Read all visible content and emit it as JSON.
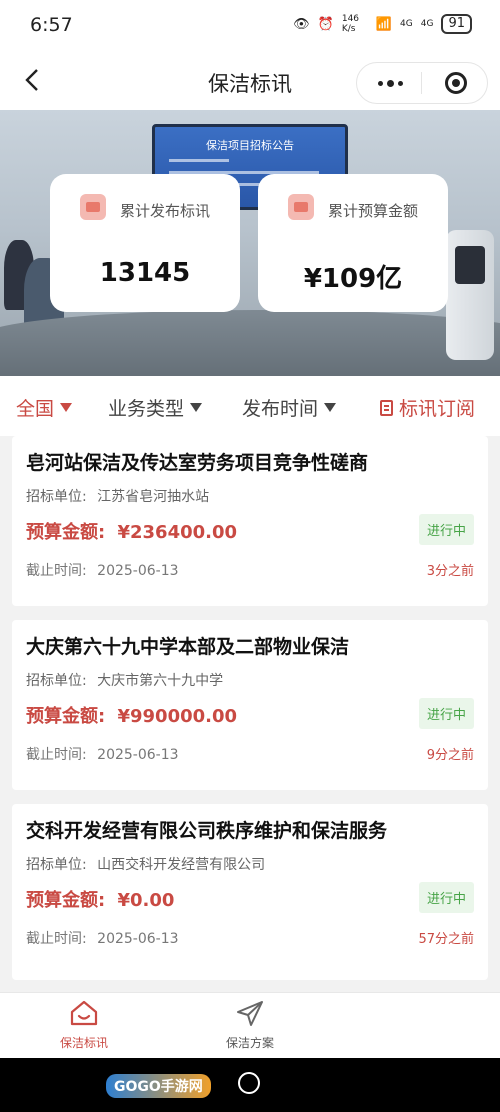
{
  "status_bar": {
    "time": "6:57",
    "net_speed": "146 K/s",
    "signal_1": "4G",
    "signal_2": "4G",
    "battery": "91"
  },
  "nav": {
    "title": "保洁标讯",
    "more_icon": "more-dots-icon",
    "target_icon": "target-icon",
    "back_icon": "chevron-left-icon"
  },
  "banner": {
    "screen_text": "保洁项目招标公告",
    "stats": [
      {
        "label": "累计发布标讯",
        "value": "13145"
      },
      {
        "label": "累计预算金额",
        "value": "¥109亿"
      }
    ]
  },
  "filters": {
    "region": "全国",
    "business_type": "业务类型",
    "publish_time": "发布时间",
    "subscribe": "标讯订阅"
  },
  "tenders": [
    {
      "title": "皂河站保洁及传达室劳务项目竞争性磋商",
      "org_label": "招标单位:",
      "org": "江苏省皂河抽水站",
      "budget_label": "预算金额:",
      "budget": "¥236400.00",
      "status": "进行中",
      "deadline_label": "截止时间:",
      "deadline": "2025-06-13",
      "ago": "3分之前"
    },
    {
      "title": "大庆第六十九中学本部及二部物业保洁",
      "org_label": "招标单位:",
      "org": "大庆市第六十九中学",
      "budget_label": "预算金额:",
      "budget": "¥990000.00",
      "status": "进行中",
      "deadline_label": "截止时间:",
      "deadline": "2025-06-13",
      "ago": "9分之前"
    },
    {
      "title": "交科开发经营有限公司秩序维护和保洁服务",
      "org_label": "招标单位:",
      "org": "山西交科开发经营有限公司",
      "budget_label": "预算金额:",
      "budget": "¥0.00",
      "status": "进行中",
      "deadline_label": "截止时间:",
      "deadline": "2025-06-13",
      "ago": "57分之前"
    }
  ],
  "tabbar": {
    "tabs": [
      {
        "label": "保洁标讯",
        "icon": "house-icon",
        "active": true
      },
      {
        "label": "保洁方案",
        "icon": "send-icon",
        "active": false
      }
    ]
  },
  "watermark": "GOGO手游网",
  "colors": {
    "accent": "#c94a43",
    "status_green": "#47a447"
  }
}
